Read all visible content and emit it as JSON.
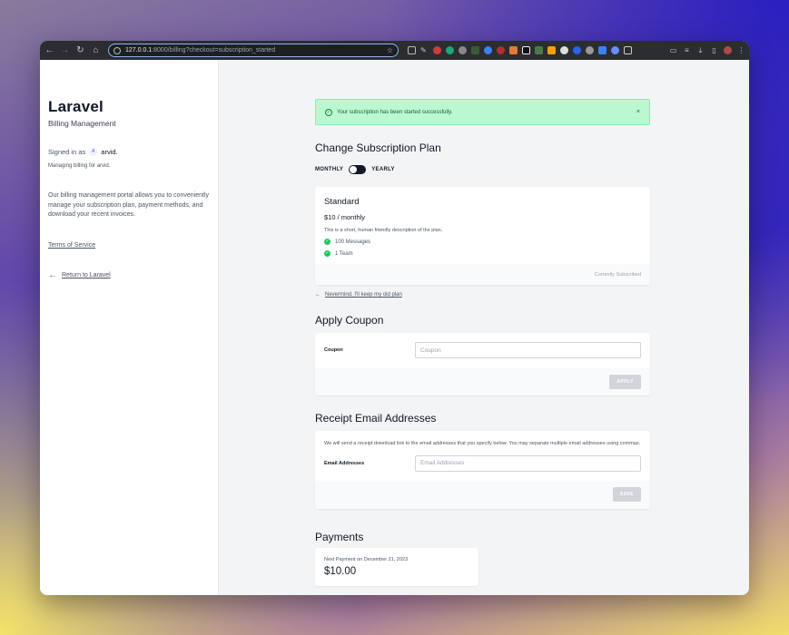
{
  "browser": {
    "url_host": "127.0.0.1",
    "url_rest": ":8000/billing?checkout=subscription_started"
  },
  "sidebar": {
    "brand": "Laravel",
    "subtitle": "Billing Management",
    "signed_in_label": "Signed in as",
    "avatar_initial": "A",
    "user_name": "arvid.",
    "managing_text": "Managing billing for arvid.",
    "description": "Our billing management portal allows you to conveniently manage your subscription plan, payment methods, and download your recent invoices.",
    "terms_link": "Terms of Service",
    "return_link": "Return to Laravel"
  },
  "alert": {
    "message": "Your subscription has been started successfully.",
    "close": "×"
  },
  "plan_section": {
    "title": "Change Subscription Plan",
    "monthly_label": "MONTHLY",
    "yearly_label": "YEARLY",
    "plan": {
      "name": "Standard",
      "price": "$10 / monthly",
      "description": "This is a short, human friendly description of the plan.",
      "features": [
        "100 Messages",
        "1 Team"
      ],
      "status": "Currently Subscribed"
    },
    "nevermind": "Nevermind, I'll keep my old plan"
  },
  "coupon_section": {
    "title": "Apply Coupon",
    "label": "Coupon",
    "placeholder": "Coupon",
    "button": "APPLY"
  },
  "receipt_section": {
    "title": "Receipt Email Addresses",
    "description": "We will send a receipt download link to the email addresses that you specify below. You may separate multiple email addresses using commas.",
    "label": "Email Addresses",
    "placeholder": "Email Addresses",
    "button": "SAVE"
  },
  "payments_section": {
    "title": "Payments",
    "next_payment": "Next Payment on December 21, 2023",
    "amount": "$10.00"
  },
  "colors": {
    "success_bg": "#bbf7d0",
    "success_text": "#166534",
    "feature_check": "#22c55e"
  }
}
